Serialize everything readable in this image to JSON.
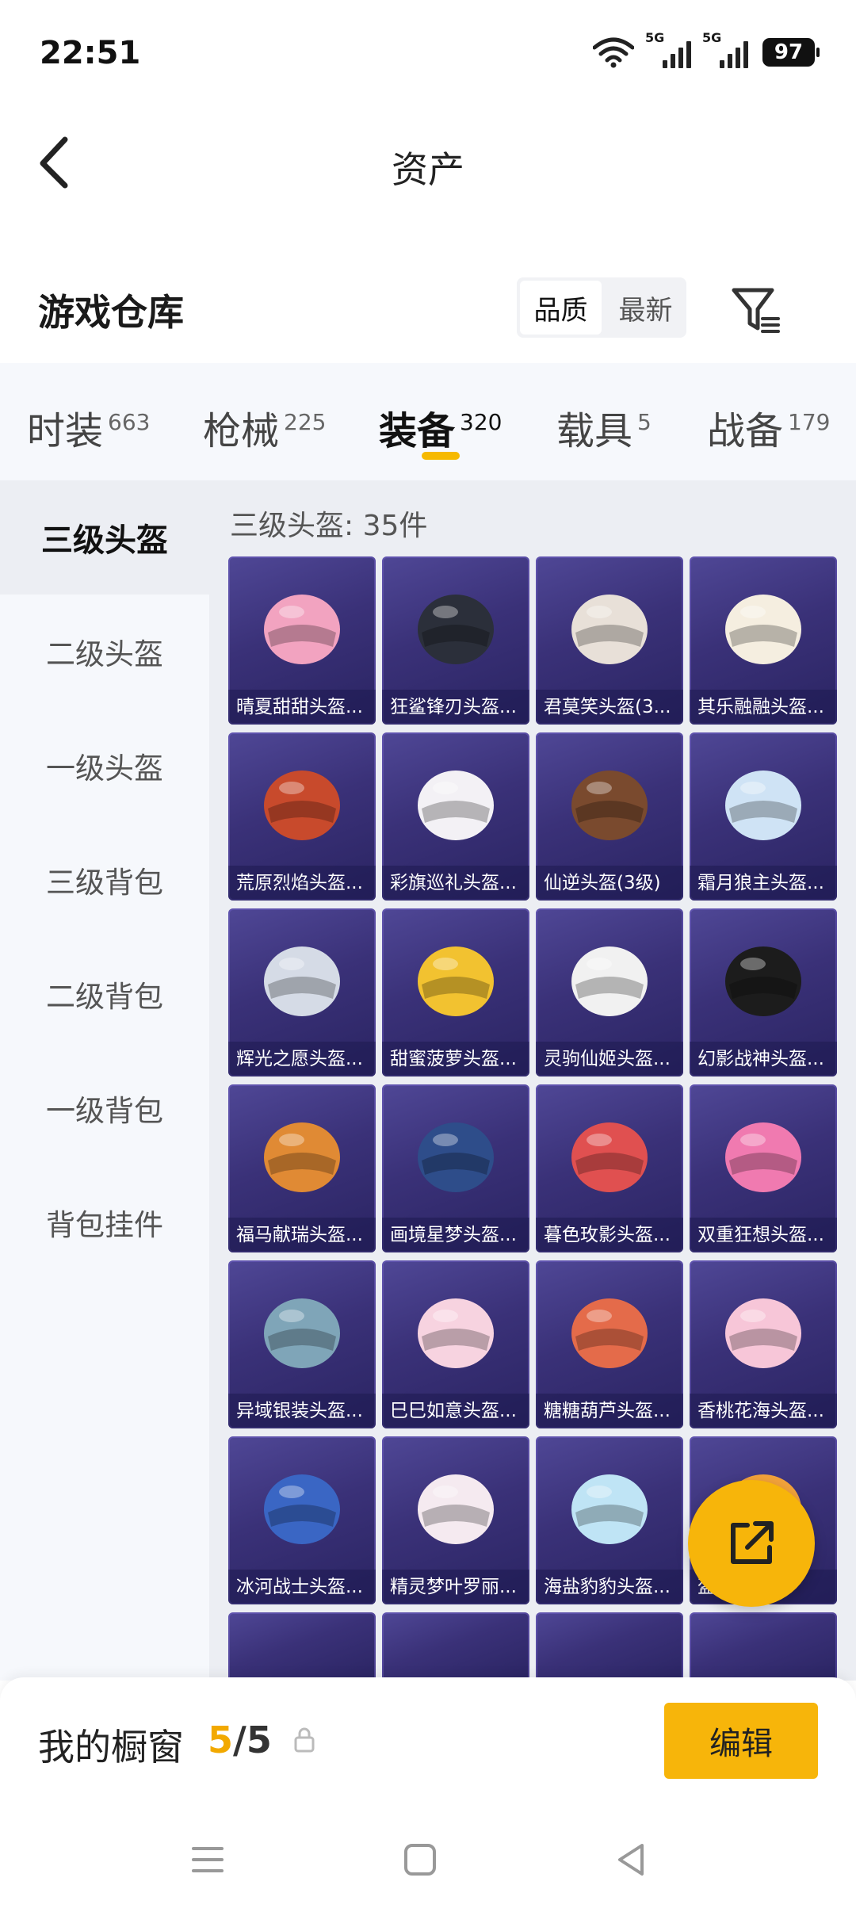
{
  "status": {
    "time": "22:51",
    "net1": "5G",
    "net2": "5G",
    "battery": "97"
  },
  "header": {
    "title": "资产"
  },
  "warehouse": {
    "title": "游戏仓库",
    "sort_quality": "品质",
    "sort_latest": "最新"
  },
  "categories": [
    {
      "label": "时装",
      "count": "663"
    },
    {
      "label": "枪械",
      "count": "225"
    },
    {
      "label": "装备",
      "count": "320"
    },
    {
      "label": "载具",
      "count": "5"
    },
    {
      "label": "战备",
      "count": "179"
    }
  ],
  "sidebar": {
    "items": [
      "三级头盔",
      "二级头盔",
      "一级头盔",
      "三级背包",
      "二级背包",
      "一级背包",
      "背包挂件"
    ]
  },
  "content": {
    "count_label": "三级头盔: 35件"
  },
  "items": [
    "晴夏甜甜头盔...",
    "狂鲨锋刃头盔...",
    "君莫笑头盔(3...",
    "其乐融融头盔...",
    "荒原烈焰头盔...",
    "彩旗巡礼头盔...",
    "仙逆头盔(3级)",
    "霜月狼主头盔...",
    "辉光之愿头盔...",
    "甜蜜菠萝头盔...",
    "灵驹仙姬头盔...",
    "幻影战神头盔...",
    "福马献瑞头盔...",
    "画境星梦头盔...",
    "暮色玫影头盔...",
    "双重狂想头盔...",
    "异域银装头盔...",
    "巳巳如意头盔...",
    "糖糖葫芦头盔...",
    "香桃花海头盔...",
    "冰河战士头盔...",
    "精灵梦叶罗丽...",
    "海盐豹豹头盔...",
    "盔..."
  ],
  "colors": {
    "accent": "#f7b50a",
    "card_bg": "#3a3178"
  },
  "showcase": {
    "label": "我的橱窗",
    "current": "5",
    "sep": "/",
    "total": "5",
    "edit": "编辑"
  }
}
